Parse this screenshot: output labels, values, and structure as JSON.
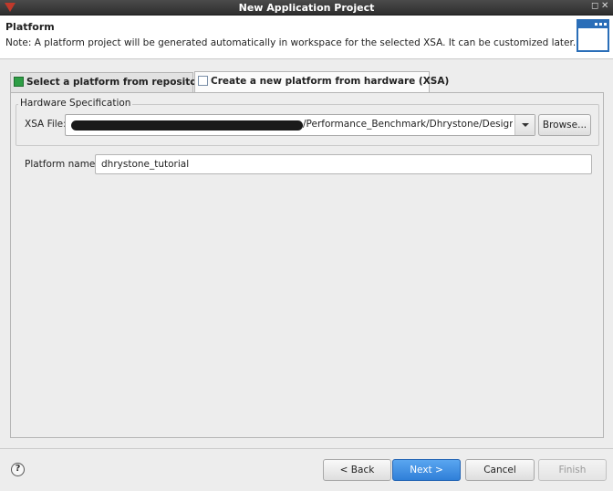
{
  "window": {
    "title": "New Application Project"
  },
  "header": {
    "title": "Platform",
    "description": "Note: A platform project will be generated automatically in workspace for the selected XSA. It can be customized later."
  },
  "tabs": [
    {
      "label": "Select a platform from repository",
      "active": false
    },
    {
      "label": "Create a new platform from hardware (XSA)",
      "active": true
    }
  ],
  "hardware_spec": {
    "group_label": "Hardware Specification",
    "xsa_label": "XSA File:",
    "xsa_value_visible": "/Performance_Benchmark/Dhrystone/Design/d",
    "browse_label": "Browse..."
  },
  "platform": {
    "label": "Platform name:",
    "value": "dhrystone_tutorial"
  },
  "footer": {
    "help_glyph": "?",
    "back_label": "< Back",
    "next_label": "Next >",
    "cancel_label": "Cancel",
    "finish_label": "Finish"
  }
}
